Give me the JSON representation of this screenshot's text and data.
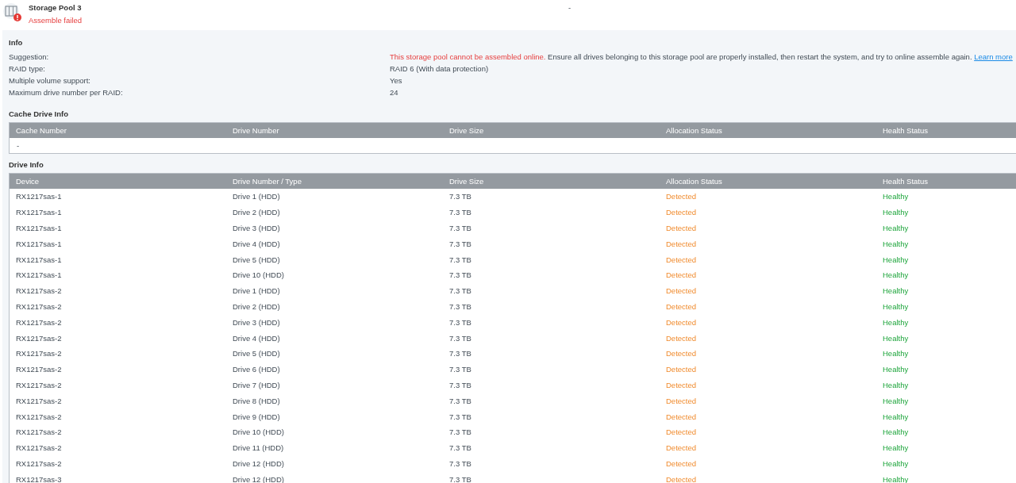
{
  "pool": {
    "name": "Storage Pool 3",
    "status": {
      "text": "Assemble failed",
      "kind": "error"
    },
    "extra": "-"
  },
  "info": {
    "title": "Info",
    "rows": [
      {
        "label": "Suggestion:",
        "kind": "suggestion",
        "warning": "This storage pool cannot be assembled online.",
        "value": "Ensure all drives belonging to this storage pool are properly installed, then restart the system, and try to online assemble again.",
        "link": "Learn more"
      },
      {
        "label": "RAID type:",
        "kind": "plain",
        "value": "RAID 6 (With data protection)"
      },
      {
        "label": "Multiple volume support:",
        "kind": "plain",
        "value": "Yes"
      },
      {
        "label": "Maximum drive number per RAID:",
        "kind": "plain",
        "value": "24"
      }
    ]
  },
  "cache": {
    "title": "Cache Drive Info",
    "columns": [
      "Cache Number",
      "Drive Number",
      "Drive Size",
      "Allocation Status",
      "Health Status"
    ],
    "empty": "-"
  },
  "drives": {
    "title": "Drive Info",
    "columns": [
      "Device",
      "Drive Number / Type",
      "Drive Size",
      "Allocation Status",
      "Health Status"
    ],
    "rows": [
      {
        "device": "RX1217sas-1",
        "drive": "Drive 1 (HDD)",
        "size": "7.3 TB",
        "allocation": {
          "text": "Detected",
          "kind": "warning"
        },
        "health": {
          "text": "Healthy",
          "kind": "good"
        }
      },
      {
        "device": "RX1217sas-1",
        "drive": "Drive 2 (HDD)",
        "size": "7.3 TB",
        "allocation": {
          "text": "Detected",
          "kind": "warning"
        },
        "health": {
          "text": "Healthy",
          "kind": "good"
        }
      },
      {
        "device": "RX1217sas-1",
        "drive": "Drive 3 (HDD)",
        "size": "7.3 TB",
        "allocation": {
          "text": "Detected",
          "kind": "warning"
        },
        "health": {
          "text": "Healthy",
          "kind": "good"
        }
      },
      {
        "device": "RX1217sas-1",
        "drive": "Drive 4 (HDD)",
        "size": "7.3 TB",
        "allocation": {
          "text": "Detected",
          "kind": "warning"
        },
        "health": {
          "text": "Healthy",
          "kind": "good"
        }
      },
      {
        "device": "RX1217sas-1",
        "drive": "Drive 5 (HDD)",
        "size": "7.3 TB",
        "allocation": {
          "text": "Detected",
          "kind": "warning"
        },
        "health": {
          "text": "Healthy",
          "kind": "good"
        }
      },
      {
        "device": "RX1217sas-1",
        "drive": "Drive 10 (HDD)",
        "size": "7.3 TB",
        "allocation": {
          "text": "Detected",
          "kind": "warning"
        },
        "health": {
          "text": "Healthy",
          "kind": "good"
        }
      },
      {
        "device": "RX1217sas-2",
        "drive": "Drive 1 (HDD)",
        "size": "7.3 TB",
        "allocation": {
          "text": "Detected",
          "kind": "warning"
        },
        "health": {
          "text": "Healthy",
          "kind": "good"
        }
      },
      {
        "device": "RX1217sas-2",
        "drive": "Drive 2 (HDD)",
        "size": "7.3 TB",
        "allocation": {
          "text": "Detected",
          "kind": "warning"
        },
        "health": {
          "text": "Healthy",
          "kind": "good"
        }
      },
      {
        "device": "RX1217sas-2",
        "drive": "Drive 3 (HDD)",
        "size": "7.3 TB",
        "allocation": {
          "text": "Detected",
          "kind": "warning"
        },
        "health": {
          "text": "Healthy",
          "kind": "good"
        }
      },
      {
        "device": "RX1217sas-2",
        "drive": "Drive 4 (HDD)",
        "size": "7.3 TB",
        "allocation": {
          "text": "Detected",
          "kind": "warning"
        },
        "health": {
          "text": "Healthy",
          "kind": "good"
        }
      },
      {
        "device": "RX1217sas-2",
        "drive": "Drive 5 (HDD)",
        "size": "7.3 TB",
        "allocation": {
          "text": "Detected",
          "kind": "warning"
        },
        "health": {
          "text": "Healthy",
          "kind": "good"
        }
      },
      {
        "device": "RX1217sas-2",
        "drive": "Drive 6 (HDD)",
        "size": "7.3 TB",
        "allocation": {
          "text": "Detected",
          "kind": "warning"
        },
        "health": {
          "text": "Healthy",
          "kind": "good"
        }
      },
      {
        "device": "RX1217sas-2",
        "drive": "Drive 7 (HDD)",
        "size": "7.3 TB",
        "allocation": {
          "text": "Detected",
          "kind": "warning"
        },
        "health": {
          "text": "Healthy",
          "kind": "good"
        }
      },
      {
        "device": "RX1217sas-2",
        "drive": "Drive 8 (HDD)",
        "size": "7.3 TB",
        "allocation": {
          "text": "Detected",
          "kind": "warning"
        },
        "health": {
          "text": "Healthy",
          "kind": "good"
        }
      },
      {
        "device": "RX1217sas-2",
        "drive": "Drive 9 (HDD)",
        "size": "7.3 TB",
        "allocation": {
          "text": "Detected",
          "kind": "warning"
        },
        "health": {
          "text": "Healthy",
          "kind": "good"
        }
      },
      {
        "device": "RX1217sas-2",
        "drive": "Drive 10 (HDD)",
        "size": "7.3 TB",
        "allocation": {
          "text": "Detected",
          "kind": "warning"
        },
        "health": {
          "text": "Healthy",
          "kind": "good"
        }
      },
      {
        "device": "RX1217sas-2",
        "drive": "Drive 11 (HDD)",
        "size": "7.3 TB",
        "allocation": {
          "text": "Detected",
          "kind": "warning"
        },
        "health": {
          "text": "Healthy",
          "kind": "good"
        }
      },
      {
        "device": "RX1217sas-2",
        "drive": "Drive 12 (HDD)",
        "size": "7.3 TB",
        "allocation": {
          "text": "Detected",
          "kind": "warning"
        },
        "health": {
          "text": "Healthy",
          "kind": "good"
        }
      },
      {
        "device": "RX1217sas-3",
        "drive": "Drive 12 (HDD)",
        "size": "7.3 TB",
        "allocation": {
          "text": "Detected",
          "kind": "warning"
        },
        "health": {
          "text": "Healthy",
          "kind": "good"
        }
      }
    ]
  }
}
